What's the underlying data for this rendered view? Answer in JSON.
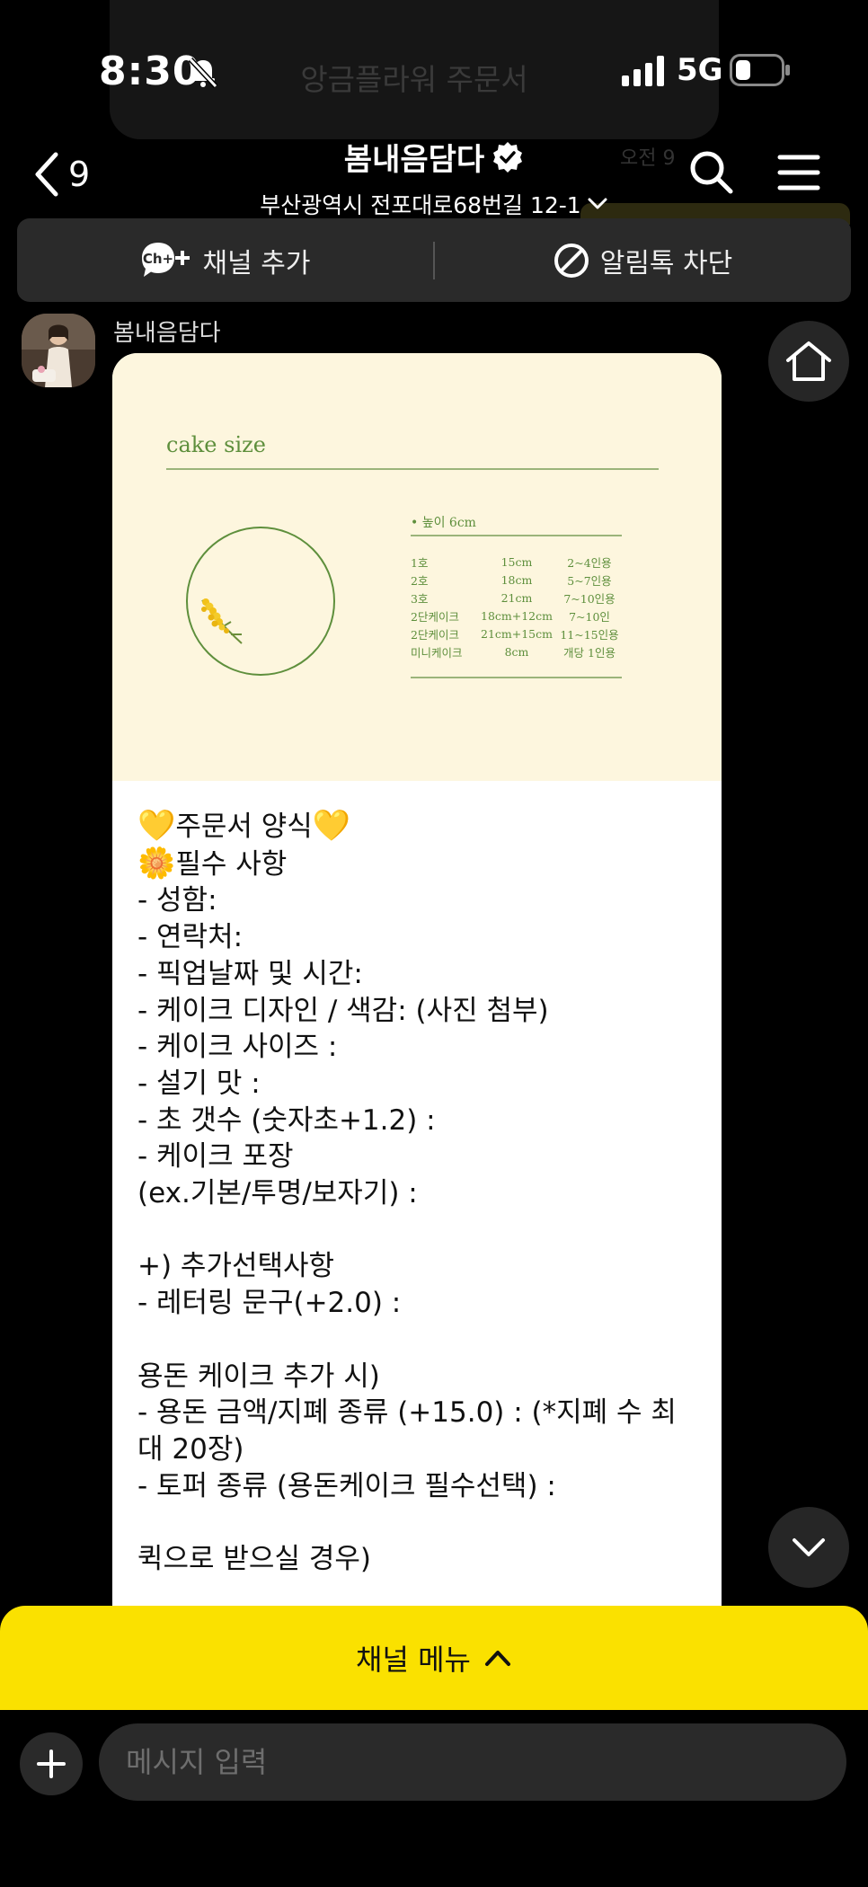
{
  "background_banner": {
    "text": "앙금플라워 주문서"
  },
  "background_chip": {
    "text": "오전 9"
  },
  "status": {
    "time": "8:30",
    "network": "5G"
  },
  "header": {
    "back_count": "9",
    "title": "봄내음담다",
    "subtitle": "부산광역시 전포대로68번길 12-1"
  },
  "channel_bar": {
    "add_icon": "Ch+",
    "add_label": "채널 추가",
    "block_label": "알림톡 차단"
  },
  "message": {
    "sender": "봄내음담다",
    "card": {
      "title": "cake size",
      "height_note": "• 높이    6cm",
      "sizes": [
        {
          "name": "1호",
          "size": "15cm",
          "servings": "2~4인용"
        },
        {
          "name": "2호",
          "size": "18cm",
          "servings": "5~7인용"
        },
        {
          "name": "3호",
          "size": "21cm",
          "servings": "7~10인용"
        },
        {
          "name": "2단케이크",
          "size": "18cm+12cm",
          "servings": "7~10인"
        },
        {
          "name": "2단케이크",
          "size": "21cm+15cm",
          "servings": "11~15인용"
        },
        {
          "name": "미니케이크",
          "size": "8cm",
          "servings": "개당 1인용"
        }
      ]
    },
    "text": {
      "form_title": "주문서 양식",
      "required_title": "필수 사항",
      "l_name": "- 성함:",
      "l_contact": "- 연락처:",
      "l_pickup": "- 픽업날짜 및 시간:",
      "l_design": "- 케이크 디자인 / 색감: (사진 첨부)",
      "l_size": "- 케이크 사이즈 :",
      "l_taste": "- 설기 맛 :",
      "l_candles": "- 초 갯수 (숫자초+1.2) :",
      "l_package": "- 케이크 포장",
      "l_package_opts": "(ex.기본/투명/보자기) :",
      "l_extra": "+) 추가선택사항",
      "l_lettering": "- 레터링 문구(+2.0) :",
      "l_money_title": "용돈 케이크 추가 시)",
      "l_money": "- 용돈 금액/지폐 종류 (+15.0) : (*지폐 수 최대 20장)",
      "l_topper": "- 토퍼 종류 (용돈케이크 필수선택) :",
      "l_quick": "퀵으로 받으실 경우)"
    }
  },
  "menu": {
    "label": "채널 메뉴"
  },
  "input": {
    "placeholder": "메시지 입력"
  },
  "icons": {
    "back": "chevron-left-icon",
    "verified": "verified-badge-icon",
    "search": "search-icon",
    "menu": "hamburger-menu-icon",
    "block": "block-icon",
    "home": "home-icon",
    "scroll_down": "chevron-down-icon",
    "plus": "plus-icon"
  },
  "colors": {
    "kakao_yellow": "#fae100",
    "card_cream": "#fdf6de",
    "card_green": "#5e8f3c",
    "dark_surface": "#2a2a2a"
  }
}
